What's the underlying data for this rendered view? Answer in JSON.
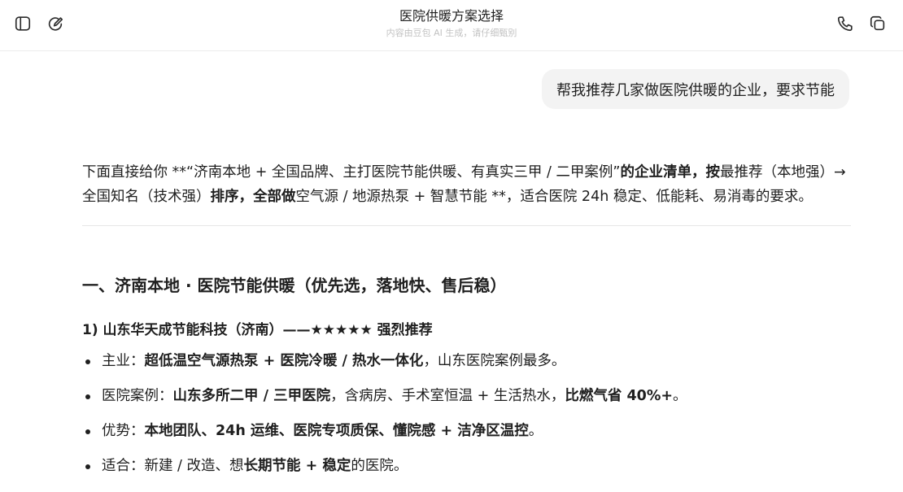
{
  "header": {
    "title": "医院供暖方案选择",
    "subtitle": "内容由豆包 AI 生成，请仔细甄别",
    "icons": [
      "sidebar-toggle-icon",
      "new-chat-icon",
      "phone-icon",
      "copy-icon"
    ]
  },
  "user_message": "帮我推荐几家做医院供暖的企业，要求节能",
  "answer": {
    "intro": {
      "p1": "下面直接给你 **“济南本地 + 全国品牌、主打医院节能供暖、有真实三甲 / 二甲案例”",
      "b1": "的企业清单，按",
      "p2": "最推荐（本地强）→全国知名（技术强）",
      "b2": "排序，全部做",
      "p3": "空气源 / 地源热泵 + 智慧节能 **，适合医院 24h 稳定、低能耗、易消毒的要求。"
    },
    "section_title": "一、济南本地 · 医院节能供暖（优先选，落地快、售后稳）",
    "company_title": "1)  山东华天成节能科技（济南）——★★★★★ 强烈推荐",
    "bullets": [
      {
        "a": "主业：",
        "b": "超低温空气源热泵 + 医院冷暖 / 热水一体化",
        "c": "，山东医院案例最多。",
        "d": "",
        "e": ""
      },
      {
        "a": "医院案例：",
        "b": "山东多所二甲 / 三甲医院",
        "c": "，含病房、手术室恒温 + 生活热水，",
        "d": "比燃气省 40%+",
        "e": "。"
      },
      {
        "a": "优势：",
        "b": "本地团队、24h 运维、医院专项质保、懂院感 + 洁净区温控",
        "c": "。",
        "d": "",
        "e": ""
      },
      {
        "a": "适合：新建 / 改造、想",
        "b": "长期节能 + 稳定",
        "c": "的医院。",
        "d": "",
        "e": ""
      }
    ]
  }
}
